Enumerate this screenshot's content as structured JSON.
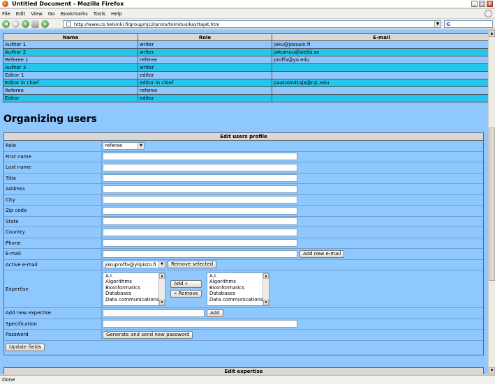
{
  "window": {
    "title": "Untitled Document - Mozilla Firefox"
  },
  "menu": [
    "File",
    "Edit",
    "View",
    "Go",
    "Bookmarks",
    "Tools",
    "Help"
  ],
  "address": {
    "url": "http://www.cs.helsinki.fi/group/njc2/proto/toimitus/kayttajat.htm"
  },
  "users_table": {
    "headers": [
      "Name",
      "Role",
      "E-mail"
    ],
    "rows": [
      {
        "name": "Author 1",
        "role": "writer",
        "email": "joku@jossain.fi"
      },
      {
        "name": "Author 2",
        "role": "writer",
        "email": "jokumuu@siellä.se"
      },
      {
        "name": "Referee 1",
        "role": "referee",
        "email": "proffa@yo.edu"
      },
      {
        "name": "Author 3",
        "role": "writer",
        "email": ""
      },
      {
        "name": "Editor 1",
        "role": "editor",
        "email": ""
      },
      {
        "name": "Editor in chief",
        "role": "editor in chief",
        "email": "paatoimittaja@njc.edu"
      },
      {
        "name": "Referee",
        "role": "referee",
        "email": ""
      },
      {
        "name": "Editor",
        "role": "editor",
        "email": ""
      }
    ]
  },
  "heading": "Organizing users",
  "profile": {
    "title": "Edit users profile",
    "labels": {
      "role": "Role",
      "first_name": "First name",
      "last_name": "Last name",
      "title": "Title",
      "address": "Address",
      "city": "City",
      "zip": "Zip code",
      "state": "State",
      "country": "Country",
      "phone": "Phone",
      "email": "E-mail",
      "active_email": "Active e-mail",
      "expertise": "Expertise",
      "add_expertise": "Add new expertise",
      "specification": "Specification",
      "password": "Password"
    },
    "role_value": "referee",
    "active_email_value": "jokuproffa@ylipisto.fi",
    "buttons": {
      "add_email": "Add new e-mail",
      "remove_selected": "Remove selected",
      "add": "Add »",
      "remove": "« Remove",
      "add_expertise": "Add",
      "generate_password": "Generate and send new password",
      "update": "Update fields"
    },
    "expertise_options": [
      "A.I.",
      "Algorithms",
      "Bioinformatics",
      "Databases",
      "Data communications"
    ]
  },
  "expertise_section": {
    "title": "Edit expertise"
  },
  "status": "Done"
}
